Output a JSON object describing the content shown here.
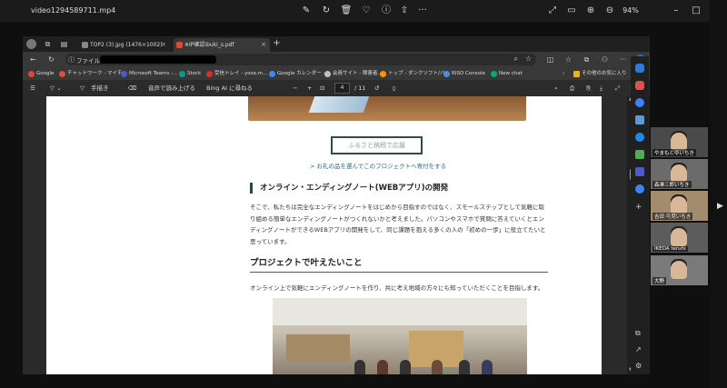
{
  "player": {
    "filename": "video1294589711.mp4",
    "zoom": "94%",
    "tools": [
      "edit-icon",
      "rotate-icon",
      "delete-icon",
      "heart-icon",
      "info-icon",
      "share-icon",
      "more-icon"
    ]
  },
  "browser": {
    "tabs": [
      {
        "label": "TOP2 (3).jpg (1476×1002)",
        "close": "×"
      },
      {
        "label": "※IP確認ibuki_s.pdf",
        "close": "×"
      }
    ],
    "new_tab": "+",
    "address_label": "ファイル",
    "bookmarks": [
      {
        "label": "Google",
        "color": "#ea4335"
      },
      {
        "label": "チャットワーク - マイチ...",
        "color": "#e04e39"
      },
      {
        "label": "Microsoft Teams -...",
        "color": "#5059c9"
      },
      {
        "label": "Stock",
        "color": "#0a9b8f"
      },
      {
        "label": "受信トレイ - yoza.m...",
        "color": "#d93025"
      },
      {
        "label": "Google カレンダー -...",
        "color": "#4285f4"
      },
      {
        "label": "会員サイト - 障害者...",
        "color": "#c0c0c0"
      },
      {
        "label": "トップ - ダンクソフト/バ...",
        "color": "#f29900"
      },
      {
        "label": "RISO Console",
        "color": "#4a90d9"
      },
      {
        "label": "New chat",
        "color": "#10a37f"
      }
    ],
    "bookmarks_more": "その他のお気に入り",
    "pdf_toolbar": {
      "draw": "手描き",
      "read_aloud": "音声で読み上げる",
      "bing": "Bing AI に尋ねる",
      "page_current": "4",
      "page_total": "/ 11",
      "minus": "−",
      "plus": "+"
    }
  },
  "pdf": {
    "button_furusato": "ふるさと納税で応援",
    "orei_link": "> お礼の品を選んでこのプロジェクトへ寄付をする",
    "heading_ending": "オンライン・エンディングノート(WEBアプリ)の開発",
    "paragraph1": "そこで、私たちは完全なエンディングノートをはじめから目指すのではなく、スモールステップとして気軽に取り組める簡単なエンディングノートがつくれないかと考えました。パソコンやスマホで質問に答えていくとエンディングノートができるWEBアプリの開発をして、同じ課題を抱える多くの人の「初めの一歩」に役立てたいと思っています。",
    "heading_kanae": "プロジェクトで叶えたいこと",
    "paragraph2": "オンライン上で気軽にエンディングノートを作り、共に考え地域の方々にも知っていただくことを目指します。"
  },
  "participants": [
    {
      "name": "やまもとゆいちき"
    },
    {
      "name": "森澤三郎いちき"
    },
    {
      "name": "吉田 可児いちき"
    },
    {
      "name": "IKEDA teruhi"
    },
    {
      "name": "大野"
    }
  ]
}
